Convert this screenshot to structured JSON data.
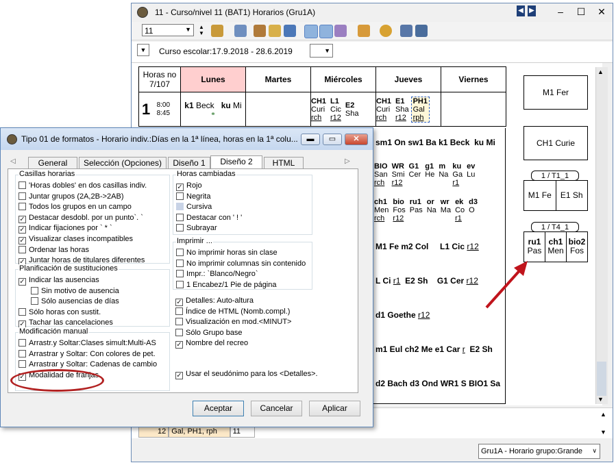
{
  "main_window": {
    "title": "11 - Curso/nivel 11 (BAT1)  Horarios  (Gru1A)",
    "class_selector_value": "11",
    "course_period": "Curso escolar:17.9.2018 - 28.6.2019",
    "status_view": "Gru1A - Horario grupo:Grande"
  },
  "timetable": {
    "hours_header": "Horas no\n7/107",
    "days": [
      "Lunes",
      "Martes",
      "Miércoles",
      "Jueves",
      "Viernes"
    ],
    "period1": {
      "number": "1",
      "start": "8:00",
      "end": "8:45"
    },
    "lunes_cells": [
      {
        "teacher": "k1",
        "room": "Beck"
      },
      {
        "teacher": "ku",
        "room": "Mi"
      }
    ],
    "miercoles_cells": [
      {
        "l1": "CH1",
        "l2": "Curi",
        "l3": "rch"
      },
      {
        "l1": "L1",
        "l2": "Cic",
        "l3": "r12"
      },
      {
        "l1": "E2",
        "l2": "Sha",
        "l3": ""
      }
    ],
    "jueves_cells": [
      {
        "l1": "CH1",
        "l2": "Curi",
        "l3": "rch"
      },
      {
        "l1": "E1",
        "l2": "Sha",
        "l3": "r12"
      },
      {
        "l1": "PH1",
        "l2": "Gal",
        "l3": "rph"
      }
    ],
    "row2": [
      "sm1 On",
      "sw1 Ba",
      "k1 Beck",
      "ku Mi"
    ],
    "row3": [
      {
        "l1": "BIO",
        "l2": "San",
        "l3": "rch"
      },
      {
        "l1": "WR",
        "l2": "Smi",
        "l3": "r12"
      },
      {
        "l1": "G1",
        "l2": "Cer",
        "l3": ""
      },
      {
        "l1": "g1",
        "l2": "He",
        "l3": ""
      },
      {
        "l1": "m",
        "l2": "Na",
        "l3": ""
      },
      {
        "l1": "ku",
        "l2": "Ga",
        "l3": "r1"
      },
      {
        "l1": "ev",
        "l2": "Lu",
        "l3": ""
      }
    ],
    "row4": [
      {
        "l1": "ch1",
        "l2": "Men",
        "l3": "rch"
      },
      {
        "l1": "bio",
        "l2": "Fos",
        "l3": "r12"
      },
      {
        "l1": "ru1",
        "l2": "Pas",
        "l3": ""
      },
      {
        "l1": "or",
        "l2": "Na",
        "l3": ""
      },
      {
        "l1": "wr",
        "l2": "Ma",
        "l3": ""
      },
      {
        "l1": "ek",
        "l2": "Co",
        "l3": "r1"
      },
      {
        "l1": "d3",
        "l2": "O",
        "l3": ""
      }
    ],
    "row5": [
      "M1 Fe",
      "m2 Col",
      "L1 Cic",
      "r12"
    ],
    "row6": [
      "L Ci",
      "r1",
      "E2 Sh",
      "G1 Cer",
      "r12"
    ],
    "row7": [
      "d1 Goethe",
      "r12"
    ],
    "row8": [
      "m1 Eul",
      "ch2 Me",
      "e1 Car",
      "r",
      "E2 Sh"
    ],
    "row9": [
      "d2 Bach",
      "d3 Ond",
      "WR1 S",
      "BIO1 Sa"
    ],
    "bottom_row": {
      "cell1": "12",
      "cell2": "Gal, PH1, rph",
      "cell3": "11"
    }
  },
  "side_panel": {
    "card1": "M1 Fer",
    "card2": "CH1 Curie",
    "group1_label": "1 / T1_1",
    "group1_items": [
      "M1 Fe",
      "E1 Sh"
    ],
    "group2_label": "1 / T4_1",
    "group2_items": [
      {
        "a": "ru1",
        "b": "Pas"
      },
      {
        "a": "ch1",
        "b": "Men"
      },
      {
        "a": "bio2",
        "b": "Fos"
      }
    ]
  },
  "dialog": {
    "title": "Tipo 01 de formatos - Horario indiv.:Días en la 1ª línea, horas en la 1ª colu...",
    "tabs": [
      "General",
      "Selección (Opciones)",
      "Diseño 1",
      "Diseño 2",
      "HTML"
    ],
    "selected_tab": "Diseño 2",
    "left_groups": [
      {
        "label": "Casillas horarias",
        "items": [
          {
            "label": "'Horas dobles' en dos casillas indiv.",
            "checked": false
          },
          {
            "label": "Juntar grupos (2A,2B->2AB)",
            "checked": false
          },
          {
            "label": "Todos los grupos en un campo",
            "checked": false
          },
          {
            "label": "Destacar desdobl. por un punto`. `",
            "checked": true
          },
          {
            "label": "Indicar fijaciones por ` * `",
            "checked": true
          },
          {
            "label": "Visualizar clases incompatibles",
            "checked": true
          },
          {
            "label": "Ordenar las horas",
            "checked": false
          },
          {
            "label": "Juntar horas de titulares diferentes",
            "checked": true
          }
        ]
      },
      {
        "label": "Planificación de sustituciones",
        "items": [
          {
            "label": "Indicar las ausencias",
            "checked": true
          },
          {
            "label": "Sin motivo de ausencia",
            "checked": false,
            "indent": true
          },
          {
            "label": "Sólo ausencias de días",
            "checked": false,
            "indent": true
          },
          {
            "label": "Sólo horas con sustit.",
            "checked": false
          },
          {
            "label": "Tachar las cancelaciones",
            "checked": true
          }
        ]
      },
      {
        "label": "Modificación manual",
        "items": [
          {
            "label": "Arrastr.y Soltar:Clases simult:Multi-AS",
            "checked": false
          },
          {
            "label": "Arrastrar y Soltar: Con colores de pet.",
            "checked": false
          },
          {
            "label": "Arrastrar y Soltar: Cadenas de cambio",
            "checked": false
          },
          {
            "label": "Modalidad de franjas",
            "checked": true
          }
        ]
      }
    ],
    "right_groups": [
      {
        "label": "Horas cambiadas",
        "items": [
          {
            "label": "Rojo",
            "checked": true
          },
          {
            "label": "Negrita",
            "checked": false
          },
          {
            "label": "Cursiva",
            "checked": false,
            "shaded": true
          },
          {
            "label": "Destacar con ' ! '",
            "checked": false
          },
          {
            "label": "Subrayar",
            "checked": false
          }
        ]
      },
      {
        "label": "Imprimir ...",
        "items": [
          {
            "label": "No imprimir horas sin clase",
            "checked": false
          },
          {
            "label": "No imprimir columnas sin contenido",
            "checked": false
          },
          {
            "label": "Impr.: `Blanco/Negro`",
            "checked": false
          },
          {
            "label": "1 Encabez/1 Pie de página",
            "checked": false
          }
        ]
      }
    ],
    "right_extra": [
      {
        "label": "Detalles: Auto-altura",
        "checked": true
      },
      {
        "label": "Índice de HTML (Nomb.compl.)",
        "checked": false
      },
      {
        "label": "Visualización en mod.<MINUT>",
        "checked": false
      },
      {
        "label": "Sólo Grupo base",
        "checked": false
      },
      {
        "label": "Nombre del recreo",
        "checked": true
      }
    ],
    "alias_option": {
      "label": "Usar el seudónimo para los <Detalles>.",
      "checked": true
    },
    "buttons": {
      "accept": "Aceptar",
      "cancel": "Cancelar",
      "apply": "Aplicar"
    }
  },
  "colors": {
    "highlight_ellipse": "#b22222",
    "arrow": "#c0141c",
    "lunes_header_bg": "#ffcfcf",
    "bottom_row_bg": "#fde9c8",
    "dialog_title_bg": "#c5d7ef"
  }
}
